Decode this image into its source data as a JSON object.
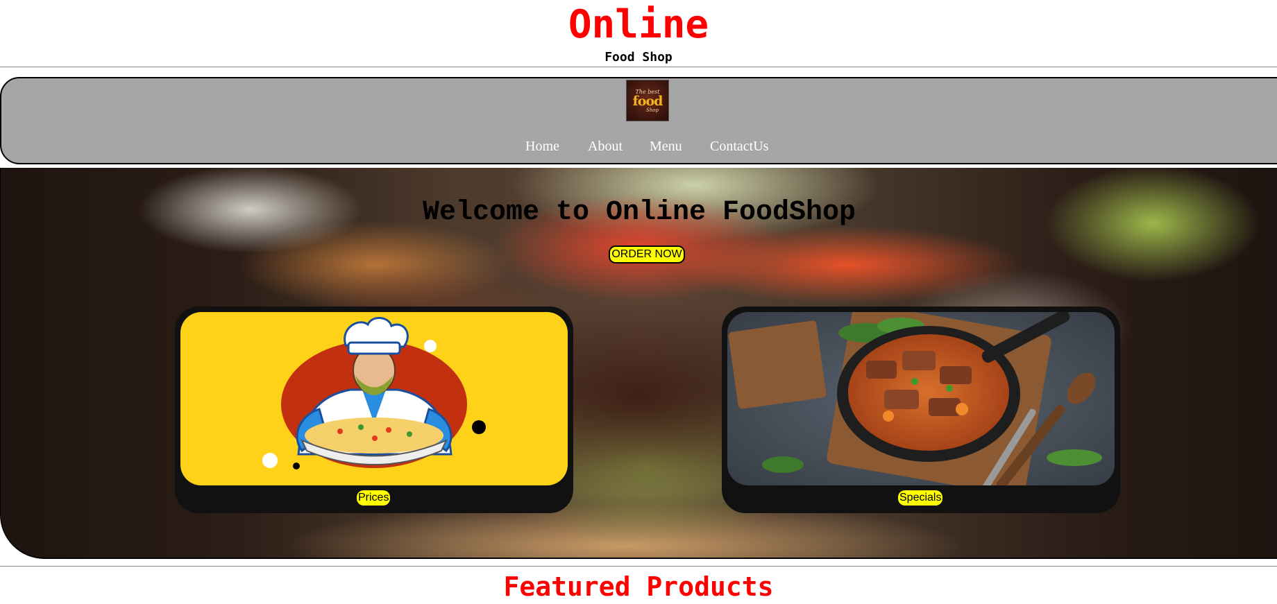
{
  "header": {
    "title": "Online",
    "subtitle": "Food Shop"
  },
  "logo": {
    "line1": "The best",
    "line2": "food",
    "line3": "Shop"
  },
  "nav": {
    "items": [
      {
        "label": "Home"
      },
      {
        "label": "About"
      },
      {
        "label": "Menu"
      },
      {
        "label": "ContactUs"
      }
    ]
  },
  "hero": {
    "title": "Welcome to Online FoodShop",
    "order_button": "ORDER NOW"
  },
  "cards": [
    {
      "label": "Prices",
      "image_icon": "chef-illustration-icon"
    },
    {
      "label": "Specials",
      "image_icon": "stew-dish-photo-icon"
    }
  ],
  "featured": {
    "title": "Featured Products"
  },
  "colors": {
    "title_red": "#ff0000",
    "nav_gray": "#a6a6a6",
    "button_yellow": "#ffff00",
    "card_dark": "#111111",
    "chef_card_bg": "#ffd21a"
  }
}
